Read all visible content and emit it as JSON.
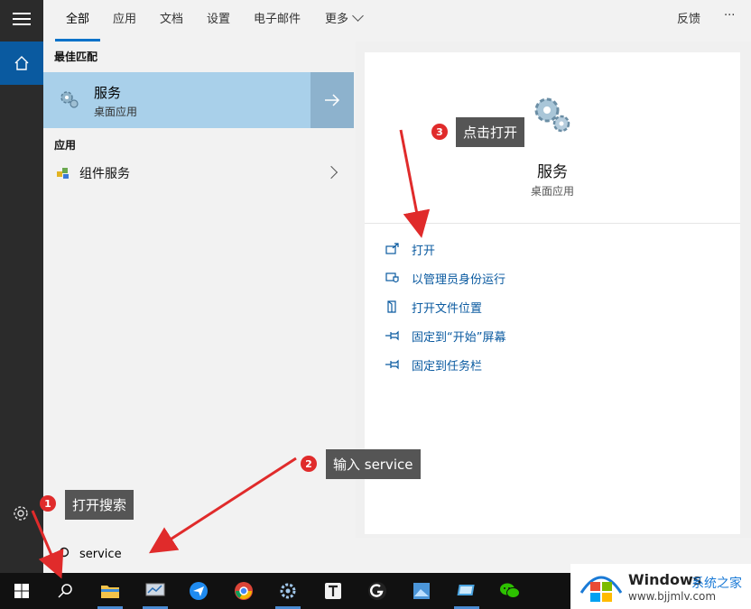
{
  "tabs": [
    {
      "label": "全部",
      "active": true
    },
    {
      "label": "应用"
    },
    {
      "label": "文档"
    },
    {
      "label": "设置"
    },
    {
      "label": "电子邮件"
    },
    {
      "label": "更多"
    }
  ],
  "tabs_right": {
    "feedback": "反馈",
    "more": "···"
  },
  "results": {
    "best_match_header": "最佳匹配",
    "best_match": {
      "name": "服务",
      "subtitle": "桌面应用",
      "icon": "gear-icon"
    },
    "apps_header": "应用",
    "apps": [
      {
        "label": "组件服务",
        "icon": "component-services-icon"
      }
    ]
  },
  "preview": {
    "title": "服务",
    "subtitle": "桌面应用",
    "actions": [
      {
        "label": "打开",
        "icon": "open-icon"
      },
      {
        "label": "以管理员身份运行",
        "icon": "shield-icon"
      },
      {
        "label": "打开文件位置",
        "icon": "file-location-icon"
      },
      {
        "label": "固定到“开始”屏幕",
        "icon": "pin-icon"
      },
      {
        "label": "固定到任务栏",
        "icon": "pin-icon"
      }
    ]
  },
  "search": {
    "value": "service"
  },
  "annotations": [
    {
      "num": "1",
      "text": "打开搜索"
    },
    {
      "num": "2",
      "text": "输入 service"
    },
    {
      "num": "3",
      "text": "点击打开"
    }
  ],
  "watermark": {
    "brand": "Windows",
    "site_name": "系统之家",
    "url": "www.bjjmlv.com"
  },
  "colors": {
    "accent": "#0a72c9",
    "selected": "#a9d0ea",
    "badge": "#e02b2b"
  }
}
